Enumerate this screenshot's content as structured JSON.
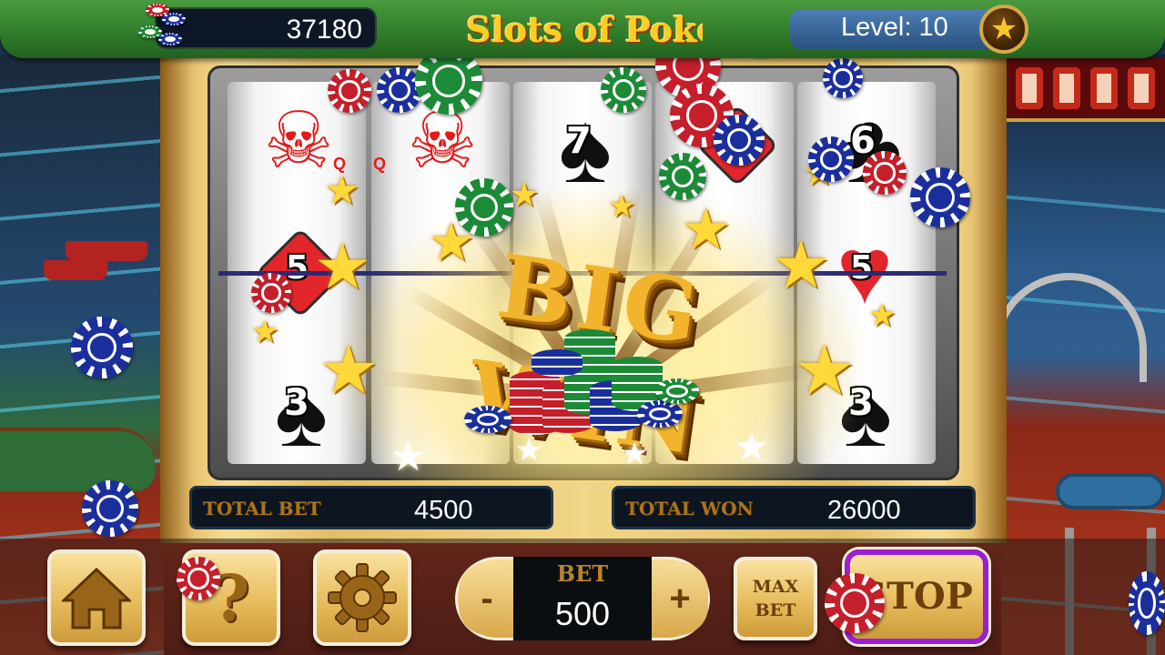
{
  "header": {
    "coins": "37180",
    "title": "Slots of Poker",
    "level_text": "Level: 10"
  },
  "reels": {
    "queen_mark": "Q",
    "top_symbols": [
      "7",
      "6"
    ],
    "middle_symbols": [
      "5",
      "5"
    ],
    "bottom_symbols": [
      "3",
      "3"
    ]
  },
  "win_banner": "BIG WIN",
  "totals": {
    "bet_label": "TOTAL BET",
    "bet_value": "4500",
    "won_label": "TOTAL WON",
    "won_value": "26000"
  },
  "controls": {
    "bet_label": "BET",
    "bet_value": "500",
    "minus": "-",
    "plus": "+",
    "help": "?",
    "max_bet_line1": "MAX",
    "max_bet_line2": "BET",
    "stop": "STOP"
  },
  "icons": [
    "coin-stack-icon",
    "star-icon",
    "home-icon",
    "question-icon",
    "gear-icon"
  ],
  "colors": {
    "topbar_green": "#2f7b2a",
    "title_gold": "#ffcc22",
    "frame_gold": "#e7c471",
    "stop_border_purple": "#9b1fd0",
    "card_red": "#e11b1b"
  }
}
